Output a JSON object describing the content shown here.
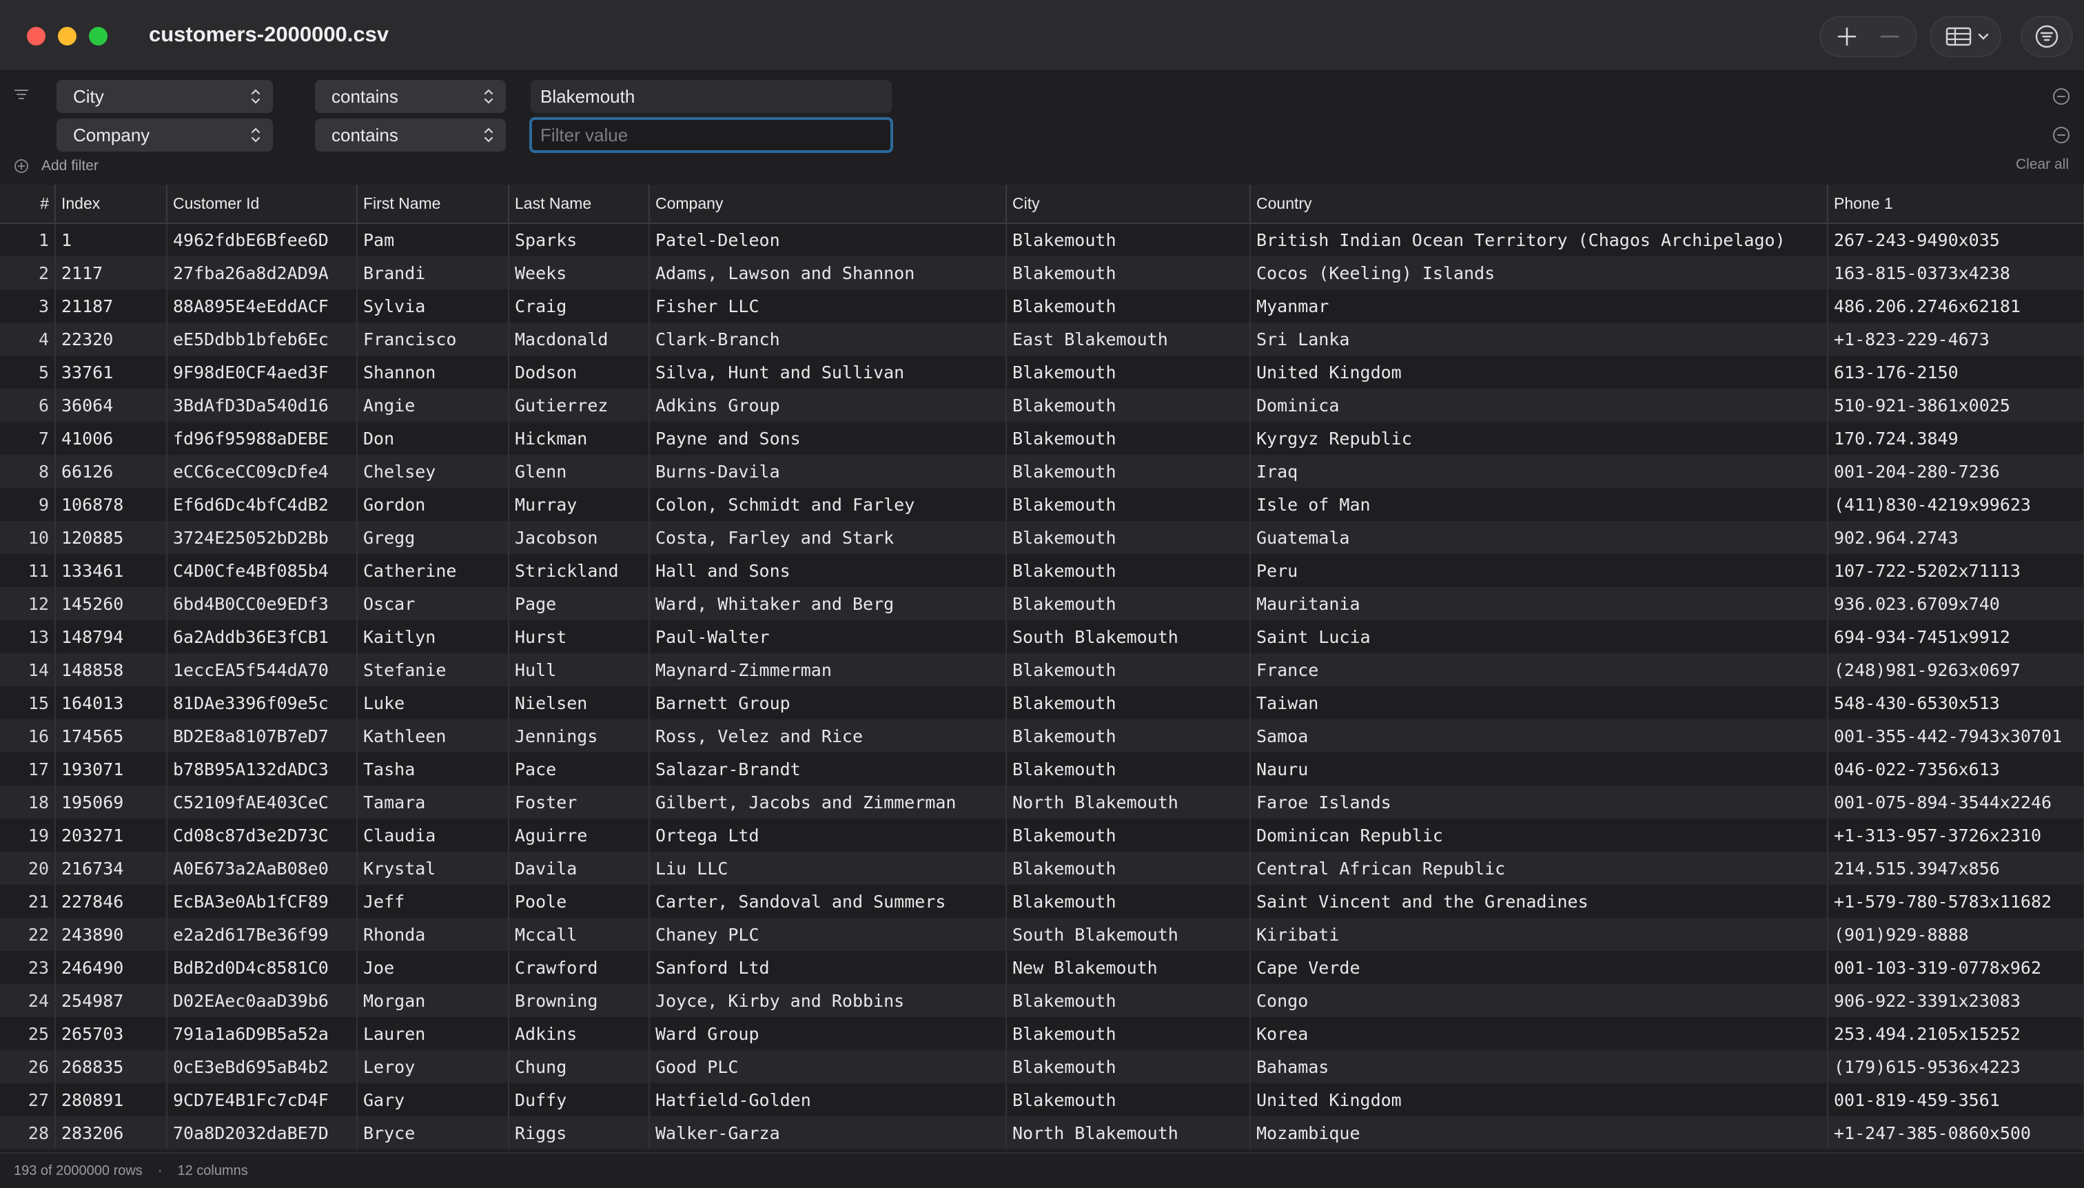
{
  "window": {
    "title": "customers-2000000.csv"
  },
  "filters": {
    "rows": [
      {
        "field": "City",
        "operator": "contains",
        "value": "Blakemouth",
        "placeholder": ""
      },
      {
        "field": "Company",
        "operator": "contains",
        "value": "",
        "placeholder": "Filter value"
      }
    ],
    "add_label": "Add filter",
    "clear_label": "Clear all"
  },
  "table": {
    "columns": [
      "#",
      "Index",
      "Customer Id",
      "First Name",
      "Last Name",
      "Company",
      "City",
      "Country",
      "Phone 1"
    ],
    "rows": [
      [
        "1",
        "1",
        "4962fdbE6Bfee6D",
        "Pam",
        "Sparks",
        "Patel-Deleon",
        "Blakemouth",
        "British Indian Ocean Territory (Chagos Archipelago)",
        "267-243-9490x035"
      ],
      [
        "2",
        "2117",
        "27fba26a8d2AD9A",
        "Brandi",
        "Weeks",
        "Adams, Lawson and Shannon",
        "Blakemouth",
        "Cocos (Keeling) Islands",
        "163-815-0373x4238"
      ],
      [
        "3",
        "21187",
        "88A895E4eEddACF",
        "Sylvia",
        "Craig",
        "Fisher LLC",
        "Blakemouth",
        "Myanmar",
        "486.206.2746x62181"
      ],
      [
        "4",
        "22320",
        "eE5Ddbb1bfeb6Ec",
        "Francisco",
        "Macdonald",
        "Clark-Branch",
        "East Blakemouth",
        "Sri Lanka",
        "+1-823-229-4673"
      ],
      [
        "5",
        "33761",
        "9F98dE0CF4aed3F",
        "Shannon",
        "Dodson",
        "Silva, Hunt and Sullivan",
        "Blakemouth",
        "United Kingdom",
        "613-176-2150"
      ],
      [
        "6",
        "36064",
        "3BdAfD3Da540d16",
        "Angie",
        "Gutierrez",
        "Adkins Group",
        "Blakemouth",
        "Dominica",
        "510-921-3861x0025"
      ],
      [
        "7",
        "41006",
        "fd96f95988aDEBE",
        "Don",
        "Hickman",
        "Payne and Sons",
        "Blakemouth",
        "Kyrgyz Republic",
        "170.724.3849"
      ],
      [
        "8",
        "66126",
        "eCC6ceCC09cDfe4",
        "Chelsey",
        "Glenn",
        "Burns-Davila",
        "Blakemouth",
        "Iraq",
        "001-204-280-7236"
      ],
      [
        "9",
        "106878",
        "Ef6d6Dc4bfC4dB2",
        "Gordon",
        "Murray",
        "Colon, Schmidt and Farley",
        "Blakemouth",
        "Isle of Man",
        "(411)830-4219x99623"
      ],
      [
        "10",
        "120885",
        "3724E25052bD2Bb",
        "Gregg",
        "Jacobson",
        "Costa, Farley and Stark",
        "Blakemouth",
        "Guatemala",
        "902.964.2743"
      ],
      [
        "11",
        "133461",
        "C4D0Cfe4Bf085b4",
        "Catherine",
        "Strickland",
        "Hall and Sons",
        "Blakemouth",
        "Peru",
        "107-722-5202x71113"
      ],
      [
        "12",
        "145260",
        "6bd4B0CC0e9EDf3",
        "Oscar",
        "Page",
        "Ward, Whitaker and Berg",
        "Blakemouth",
        "Mauritania",
        "936.023.6709x740"
      ],
      [
        "13",
        "148794",
        "6a2Addb36E3fCB1",
        "Kaitlyn",
        "Hurst",
        "Paul-Walter",
        "South Blakemouth",
        "Saint Lucia",
        "694-934-7451x9912"
      ],
      [
        "14",
        "148858",
        "1eccEA5f544dA70",
        "Stefanie",
        "Hull",
        "Maynard-Zimmerman",
        "Blakemouth",
        "France",
        "(248)981-9263x0697"
      ],
      [
        "15",
        "164013",
        "81DAe3396f09e5c",
        "Luke",
        "Nielsen",
        "Barnett Group",
        "Blakemouth",
        "Taiwan",
        "548-430-6530x513"
      ],
      [
        "16",
        "174565",
        "BD2E8a8107B7eD7",
        "Kathleen",
        "Jennings",
        "Ross, Velez and Rice",
        "Blakemouth",
        "Samoa",
        "001-355-442-7943x30701"
      ],
      [
        "17",
        "193071",
        "b78B95A132dADC3",
        "Tasha",
        "Pace",
        "Salazar-Brandt",
        "Blakemouth",
        "Nauru",
        "046-022-7356x613"
      ],
      [
        "18",
        "195069",
        "C52109fAE403CeC",
        "Tamara",
        "Foster",
        "Gilbert, Jacobs and Zimmerman",
        "North Blakemouth",
        "Faroe Islands",
        "001-075-894-3544x2246"
      ],
      [
        "19",
        "203271",
        "Cd08c87d3e2D73C",
        "Claudia",
        "Aguirre",
        "Ortega Ltd",
        "Blakemouth",
        "Dominican Republic",
        "+1-313-957-3726x2310"
      ],
      [
        "20",
        "216734",
        "A0E673a2AaB08e0",
        "Krystal",
        "Davila",
        "Liu LLC",
        "Blakemouth",
        "Central African Republic",
        "214.515.3947x856"
      ],
      [
        "21",
        "227846",
        "EcBA3e0Ab1fCF89",
        "Jeff",
        "Poole",
        "Carter, Sandoval and Summers",
        "Blakemouth",
        "Saint Vincent and the Grenadines",
        "+1-579-780-5783x11682"
      ],
      [
        "22",
        "243890",
        "e2a2d617Be36f99",
        "Rhonda",
        "Mccall",
        "Chaney PLC",
        "South Blakemouth",
        "Kiribati",
        "(901)929-8888"
      ],
      [
        "23",
        "246490",
        "BdB2d0D4c8581C0",
        "Joe",
        "Crawford",
        "Sanford Ltd",
        "New Blakemouth",
        "Cape Verde",
        "001-103-319-0778x962"
      ],
      [
        "24",
        "254987",
        "D02EAec0aaD39b6",
        "Morgan",
        "Browning",
        "Joyce, Kirby and Robbins",
        "Blakemouth",
        "Congo",
        "906-922-3391x23083"
      ],
      [
        "25",
        "265703",
        "791a1a6D9B5a52a",
        "Lauren",
        "Adkins",
        "Ward Group",
        "Blakemouth",
        "Korea",
        "253.494.2105x15252"
      ],
      [
        "26",
        "268835",
        "0cE3eBd695aB4b2",
        "Leroy",
        "Chung",
        "Good PLC",
        "Blakemouth",
        "Bahamas",
        "(179)615-9536x4223"
      ],
      [
        "27",
        "280891",
        "9CD7E4B1Fc7cD4F",
        "Gary",
        "Duffy",
        "Hatfield-Golden",
        "Blakemouth",
        "United Kingdom",
        "001-819-459-3561"
      ],
      [
        "28",
        "283206",
        "70a8D2032daBE7D",
        "Bryce",
        "Riggs",
        "Walker-Garza",
        "North Blakemouth",
        "Mozambique",
        "+1-247-385-0860x500"
      ]
    ]
  },
  "status": {
    "rows_text": "193 of 2000000 rows",
    "separator": "·",
    "columns_text": "12 columns"
  },
  "icons": {
    "toolbar": [
      "plus-icon",
      "minus-icon",
      "table-view-icon",
      "chevron-down-icon",
      "filter-lines-icon"
    ],
    "filters": [
      "filter-list-icon",
      "updown-chevron-icon",
      "remove-circle-icon",
      "add-circle-icon"
    ]
  },
  "colors": {
    "close": "#fe5f57",
    "minimize": "#febc2e",
    "maximize": "#28c840",
    "focus_ring": "#2c6a9a"
  }
}
